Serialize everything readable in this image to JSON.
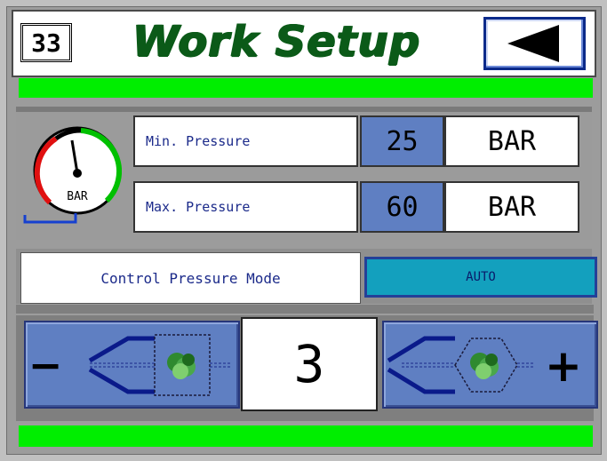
{
  "header": {
    "page_number": "33",
    "title": "Work Setup",
    "back_icon": "triangle-left-icon"
  },
  "gauge": {
    "unit_label": "BAR",
    "colors": {
      "low": "#e01010",
      "high": "#00c000"
    }
  },
  "pressure": {
    "min": {
      "label": "Min. Pressure",
      "value": "25",
      "unit": "BAR"
    },
    "max": {
      "label": "Max. Pressure",
      "value": "60",
      "unit": "BAR"
    }
  },
  "mode": {
    "label": "Control Pressure Mode",
    "value": "AUTO"
  },
  "stepper": {
    "value": "3",
    "minus_label": "−",
    "plus_label": "+"
  },
  "colors": {
    "title_green": "#0b5a18",
    "bar_green": "#00ee00",
    "value_blue": "#5f7fc2",
    "mode_cyan": "#13a0be"
  }
}
